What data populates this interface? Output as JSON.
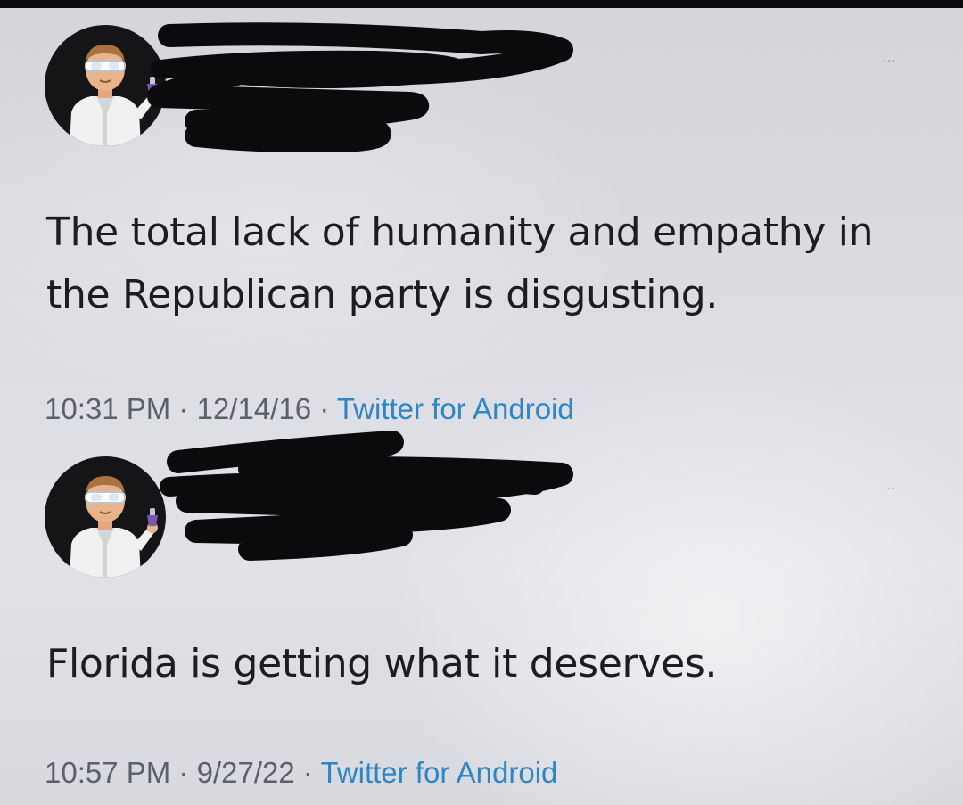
{
  "tweets": [
    {
      "text": "The total lack of humanity and empathy in the Republican party is disgusting.",
      "time": "10:31 PM",
      "date": "12/14/16",
      "separator": "·",
      "source": "Twitter for Android",
      "more_icon": "···"
    },
    {
      "text": "Florida is getting what it deserves.",
      "time": "10:57 PM",
      "date": "9/27/22",
      "separator": "·",
      "source": "Twitter for Android",
      "more_icon": "···"
    }
  ],
  "colors": {
    "text": "#1c1d21",
    "meta": "#5c6068",
    "source_link": "#2f86c6",
    "redaction": "#0b0b0d"
  }
}
